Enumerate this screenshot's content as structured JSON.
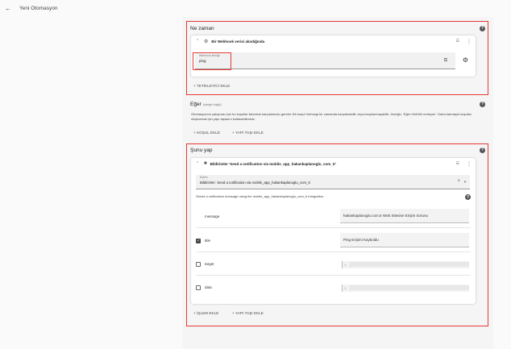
{
  "header": {
    "back_icon": "arrow-left-icon",
    "title": "Yeni Otomasyon"
  },
  "trigger_section": {
    "title": "Ne zaman",
    "card": {
      "title": "Bir Webhook verisi alındığında",
      "field_label": "Webhook kimliği",
      "field_value": "ping"
    },
    "add_button": "+ TETİKLEYİCİ EKLE"
  },
  "condition_section": {
    "title": "Eğer",
    "title_suffix": "(isteğe bağlı)",
    "description": "Otomasyonun çalışması için bu koşullar listesinin karşılanması gerekir. Bir koşul herhangi bir zamanda karşılanabilir veya karşılanmayabilir, örneğin: 'Eğer HAKAN evdeyse'. Daha karmaşık koşullar oluşturmak için yapı taşlarını kullanabilirsiniz.",
    "add_condition_button": "+ KOŞUL EKLE",
    "add_block_button": "+ YAPI TAŞI EKLE"
  },
  "action_section": {
    "title": "Şunu yap",
    "card": {
      "title": "Bildirimler 'Send a notification via mobile_app_hakankaplanoglu_com_tr'",
      "action_label": "Eylem",
      "action_value": "Bildirimler: Send a notification via mobile_app_hakankaplanoglu_com_tr",
      "description": "Sends a notification message using the mobile_app_hakankaplanoglu_com_tr integration.",
      "params": [
        {
          "name": "message",
          "value": "hakankaplanoglu.com.tr Web Sitesine Erişim Sorunu",
          "checked": false,
          "has_checkbox": false
        },
        {
          "name": "title",
          "value": "Ping Erişimi Kayboldu",
          "checked": true,
          "has_checkbox": true
        },
        {
          "name": "target",
          "value": "1",
          "checked": false,
          "has_checkbox": true
        },
        {
          "name": "data",
          "value": "1",
          "checked": false,
          "has_checkbox": true
        }
      ]
    },
    "add_action_button": "+ İŞLEM EKLE",
    "add_block_button": "+ YAPI TAŞI EKLE"
  },
  "colors": {
    "highlight_border": "#e53935",
    "background": "#fafafa"
  }
}
